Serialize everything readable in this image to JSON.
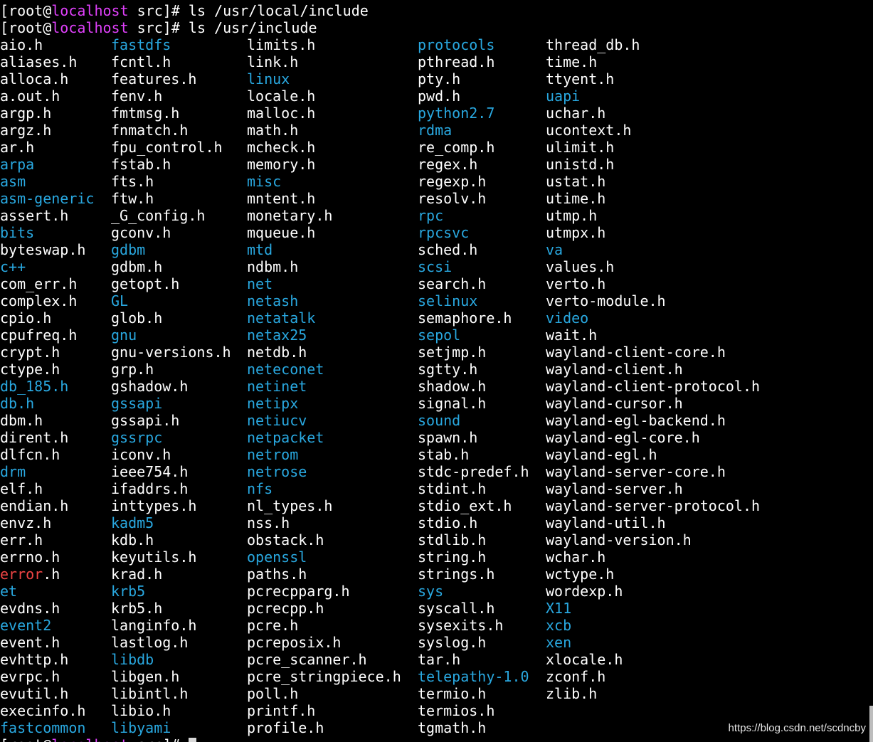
{
  "terminal": {
    "colors": {
      "background": "#000000",
      "text": "#ffffff",
      "directory": "#29a8e0",
      "hostname": "#e040fb",
      "broken_link": "#ef4444"
    },
    "prompt_lines": [
      {
        "user_part": "[root@",
        "host": "localhost",
        "path_part": " src]# ",
        "command": "ls /usr/local/include"
      },
      {
        "user_part": "[root@",
        "host": "localhost",
        "path_part": " src]# ",
        "command": "ls /usr/include"
      }
    ],
    "bottom_prompt": {
      "user_part": "[root@",
      "host": "localhost",
      "path_part": " src]# "
    }
  },
  "listing": {
    "columns": [
      [
        {
          "name": "aio.h",
          "type": "file"
        },
        {
          "name": "aliases.h",
          "type": "file"
        },
        {
          "name": "alloca.h",
          "type": "file"
        },
        {
          "name": "a.out.h",
          "type": "file"
        },
        {
          "name": "argp.h",
          "type": "file"
        },
        {
          "name": "argz.h",
          "type": "file"
        },
        {
          "name": "ar.h",
          "type": "file"
        },
        {
          "name": "arpa",
          "type": "dir"
        },
        {
          "name": "asm",
          "type": "dir"
        },
        {
          "name": "asm-generic",
          "type": "dir"
        },
        {
          "name": "assert.h",
          "type": "file"
        },
        {
          "name": "bits",
          "type": "dir"
        },
        {
          "name": "byteswap.h",
          "type": "file"
        },
        {
          "name": "c++",
          "type": "dir"
        },
        {
          "name": "com_err.h",
          "type": "file"
        },
        {
          "name": "complex.h",
          "type": "file"
        },
        {
          "name": "cpio.h",
          "type": "file"
        },
        {
          "name": "cpufreq.h",
          "type": "file"
        },
        {
          "name": "crypt.h",
          "type": "file"
        },
        {
          "name": "ctype.h",
          "type": "file"
        },
        {
          "name": "db_185.h",
          "type": "link"
        },
        {
          "name": "db.h",
          "type": "link"
        },
        {
          "name": "dbm.h",
          "type": "file"
        },
        {
          "name": "dirent.h",
          "type": "file"
        },
        {
          "name": "dlfcn.h",
          "type": "file"
        },
        {
          "name": "drm",
          "type": "dir"
        },
        {
          "name": "elf.h",
          "type": "file"
        },
        {
          "name": "endian.h",
          "type": "file"
        },
        {
          "name": "envz.h",
          "type": "file"
        },
        {
          "name": "err.h",
          "type": "file"
        },
        {
          "name": "errno.h",
          "type": "file"
        },
        {
          "name": "error",
          "suffix": ".h",
          "type": "broken"
        },
        {
          "name": "et",
          "type": "dir"
        },
        {
          "name": "evdns.h",
          "type": "file"
        },
        {
          "name": "event2",
          "type": "dir"
        },
        {
          "name": "event.h",
          "type": "file"
        },
        {
          "name": "evhttp.h",
          "type": "file"
        },
        {
          "name": "evrpc.h",
          "type": "file"
        },
        {
          "name": "evutil.h",
          "type": "file"
        },
        {
          "name": "execinfo.h",
          "type": "file"
        },
        {
          "name": "fastcommon",
          "type": "dir"
        }
      ],
      [
        {
          "name": "fastdfs",
          "type": "dir"
        },
        {
          "name": "fcntl.h",
          "type": "file"
        },
        {
          "name": "features.h",
          "type": "file"
        },
        {
          "name": "fenv.h",
          "type": "file"
        },
        {
          "name": "fmtmsg.h",
          "type": "file"
        },
        {
          "name": "fnmatch.h",
          "type": "file"
        },
        {
          "name": "fpu_control.h",
          "type": "file"
        },
        {
          "name": "fstab.h",
          "type": "file"
        },
        {
          "name": "fts.h",
          "type": "file"
        },
        {
          "name": "ftw.h",
          "type": "file"
        },
        {
          "name": "_G_config.h",
          "type": "file"
        },
        {
          "name": "gconv.h",
          "type": "file"
        },
        {
          "name": "gdbm",
          "type": "dir"
        },
        {
          "name": "gdbm.h",
          "type": "file"
        },
        {
          "name": "getopt.h",
          "type": "file"
        },
        {
          "name": "GL",
          "type": "dir"
        },
        {
          "name": "glob.h",
          "type": "file"
        },
        {
          "name": "gnu",
          "type": "dir"
        },
        {
          "name": "gnu-versions.h",
          "type": "file"
        },
        {
          "name": "grp.h",
          "type": "file"
        },
        {
          "name": "gshadow.h",
          "type": "file"
        },
        {
          "name": "gssapi",
          "type": "dir"
        },
        {
          "name": "gssapi.h",
          "type": "file"
        },
        {
          "name": "gssrpc",
          "type": "dir"
        },
        {
          "name": "iconv.h",
          "type": "file"
        },
        {
          "name": "ieee754.h",
          "type": "file"
        },
        {
          "name": "ifaddrs.h",
          "type": "file"
        },
        {
          "name": "inttypes.h",
          "type": "file"
        },
        {
          "name": "kadm5",
          "type": "dir"
        },
        {
          "name": "kdb.h",
          "type": "file"
        },
        {
          "name": "keyutils.h",
          "type": "file"
        },
        {
          "name": "krad.h",
          "type": "file"
        },
        {
          "name": "krb5",
          "type": "dir"
        },
        {
          "name": "krb5.h",
          "type": "file"
        },
        {
          "name": "langinfo.h",
          "type": "file"
        },
        {
          "name": "lastlog.h",
          "type": "file"
        },
        {
          "name": "libdb",
          "type": "dir"
        },
        {
          "name": "libgen.h",
          "type": "file"
        },
        {
          "name": "libintl.h",
          "type": "file"
        },
        {
          "name": "libio.h",
          "type": "file"
        },
        {
          "name": "libyami",
          "type": "dir"
        }
      ],
      [
        {
          "name": "limits.h",
          "type": "file"
        },
        {
          "name": "link.h",
          "type": "file"
        },
        {
          "name": "linux",
          "type": "dir"
        },
        {
          "name": "locale.h",
          "type": "file"
        },
        {
          "name": "malloc.h",
          "type": "file"
        },
        {
          "name": "math.h",
          "type": "file"
        },
        {
          "name": "mcheck.h",
          "type": "file"
        },
        {
          "name": "memory.h",
          "type": "file"
        },
        {
          "name": "misc",
          "type": "dir"
        },
        {
          "name": "mntent.h",
          "type": "file"
        },
        {
          "name": "monetary.h",
          "type": "file"
        },
        {
          "name": "mqueue.h",
          "type": "file"
        },
        {
          "name": "mtd",
          "type": "dir"
        },
        {
          "name": "ndbm.h",
          "type": "file"
        },
        {
          "name": "net",
          "type": "dir"
        },
        {
          "name": "netash",
          "type": "dir"
        },
        {
          "name": "netatalk",
          "type": "dir"
        },
        {
          "name": "netax25",
          "type": "dir"
        },
        {
          "name": "netdb.h",
          "type": "file"
        },
        {
          "name": "neteconet",
          "type": "dir"
        },
        {
          "name": "netinet",
          "type": "dir"
        },
        {
          "name": "netipx",
          "type": "dir"
        },
        {
          "name": "netiucv",
          "type": "dir"
        },
        {
          "name": "netpacket",
          "type": "dir"
        },
        {
          "name": "netrom",
          "type": "dir"
        },
        {
          "name": "netrose",
          "type": "dir"
        },
        {
          "name": "nfs",
          "type": "dir"
        },
        {
          "name": "nl_types.h",
          "type": "file"
        },
        {
          "name": "nss.h",
          "type": "file"
        },
        {
          "name": "obstack.h",
          "type": "file"
        },
        {
          "name": "openssl",
          "type": "dir"
        },
        {
          "name": "paths.h",
          "type": "file"
        },
        {
          "name": "pcrecpparg.h",
          "type": "file"
        },
        {
          "name": "pcrecpp.h",
          "type": "file"
        },
        {
          "name": "pcre.h",
          "type": "file"
        },
        {
          "name": "pcreposix.h",
          "type": "file"
        },
        {
          "name": "pcre_scanner.h",
          "type": "file"
        },
        {
          "name": "pcre_stringpiece.h",
          "type": "file"
        },
        {
          "name": "poll.h",
          "type": "file"
        },
        {
          "name": "printf.h",
          "type": "file"
        },
        {
          "name": "profile.h",
          "type": "file"
        }
      ],
      [
        {
          "name": "protocols",
          "type": "dir"
        },
        {
          "name": "pthread.h",
          "type": "file"
        },
        {
          "name": "pty.h",
          "type": "file"
        },
        {
          "name": "pwd.h",
          "type": "file"
        },
        {
          "name": "python2.7",
          "type": "dir"
        },
        {
          "name": "rdma",
          "type": "dir"
        },
        {
          "name": "re_comp.h",
          "type": "file"
        },
        {
          "name": "regex.h",
          "type": "file"
        },
        {
          "name": "regexp.h",
          "type": "file"
        },
        {
          "name": "resolv.h",
          "type": "file"
        },
        {
          "name": "rpc",
          "type": "dir"
        },
        {
          "name": "rpcsvc",
          "type": "dir"
        },
        {
          "name": "sched.h",
          "type": "file"
        },
        {
          "name": "scsi",
          "type": "dir"
        },
        {
          "name": "search.h",
          "type": "file"
        },
        {
          "name": "selinux",
          "type": "dir"
        },
        {
          "name": "semaphore.h",
          "type": "file"
        },
        {
          "name": "sepol",
          "type": "dir"
        },
        {
          "name": "setjmp.h",
          "type": "file"
        },
        {
          "name": "sgtty.h",
          "type": "file"
        },
        {
          "name": "shadow.h",
          "type": "file"
        },
        {
          "name": "signal.h",
          "type": "file"
        },
        {
          "name": "sound",
          "type": "dir"
        },
        {
          "name": "spawn.h",
          "type": "file"
        },
        {
          "name": "stab.h",
          "type": "file"
        },
        {
          "name": "stdc-predef.h",
          "type": "file"
        },
        {
          "name": "stdint.h",
          "type": "file"
        },
        {
          "name": "stdio_ext.h",
          "type": "file"
        },
        {
          "name": "stdio.h",
          "type": "file"
        },
        {
          "name": "stdlib.h",
          "type": "file"
        },
        {
          "name": "string.h",
          "type": "file"
        },
        {
          "name": "strings.h",
          "type": "file"
        },
        {
          "name": "sys",
          "type": "dir"
        },
        {
          "name": "syscall.h",
          "type": "file"
        },
        {
          "name": "sysexits.h",
          "type": "file"
        },
        {
          "name": "syslog.h",
          "type": "file"
        },
        {
          "name": "tar.h",
          "type": "file"
        },
        {
          "name": "telepathy-1.0",
          "type": "dir"
        },
        {
          "name": "termio.h",
          "type": "file"
        },
        {
          "name": "termios.h",
          "type": "file"
        },
        {
          "name": "tgmath.h",
          "type": "file"
        }
      ],
      [
        {
          "name": "thread_db.h",
          "type": "file"
        },
        {
          "name": "time.h",
          "type": "file"
        },
        {
          "name": "ttyent.h",
          "type": "file"
        },
        {
          "name": "uapi",
          "type": "dir"
        },
        {
          "name": "uchar.h",
          "type": "file"
        },
        {
          "name": "ucontext.h",
          "type": "file"
        },
        {
          "name": "ulimit.h",
          "type": "file"
        },
        {
          "name": "unistd.h",
          "type": "file"
        },
        {
          "name": "ustat.h",
          "type": "file"
        },
        {
          "name": "utime.h",
          "type": "file"
        },
        {
          "name": "utmp.h",
          "type": "file"
        },
        {
          "name": "utmpx.h",
          "type": "file"
        },
        {
          "name": "va",
          "type": "dir"
        },
        {
          "name": "values.h",
          "type": "file"
        },
        {
          "name": "verto.h",
          "type": "file"
        },
        {
          "name": "verto-module.h",
          "type": "file"
        },
        {
          "name": "video",
          "type": "dir"
        },
        {
          "name": "wait.h",
          "type": "file"
        },
        {
          "name": "wayland-client-core.h",
          "type": "file"
        },
        {
          "name": "wayland-client.h",
          "type": "file"
        },
        {
          "name": "wayland-client-protocol.h",
          "type": "file"
        },
        {
          "name": "wayland-cursor.h",
          "type": "file"
        },
        {
          "name": "wayland-egl-backend.h",
          "type": "file"
        },
        {
          "name": "wayland-egl-core.h",
          "type": "file"
        },
        {
          "name": "wayland-egl.h",
          "type": "file"
        },
        {
          "name": "wayland-server-core.h",
          "type": "file"
        },
        {
          "name": "wayland-server.h",
          "type": "file"
        },
        {
          "name": "wayland-server-protocol.h",
          "type": "file"
        },
        {
          "name": "wayland-util.h",
          "type": "file"
        },
        {
          "name": "wayland-version.h",
          "type": "file"
        },
        {
          "name": "wchar.h",
          "type": "file"
        },
        {
          "name": "wctype.h",
          "type": "file"
        },
        {
          "name": "wordexp.h",
          "type": "file"
        },
        {
          "name": "X11",
          "type": "dir"
        },
        {
          "name": "xcb",
          "type": "dir"
        },
        {
          "name": "xen",
          "type": "dir"
        },
        {
          "name": "xlocale.h",
          "type": "file"
        },
        {
          "name": "zconf.h",
          "type": "file"
        },
        {
          "name": "zlib.h",
          "type": "file"
        }
      ]
    ]
  },
  "watermark": {
    "text": "https://blog.csdn.net/scdncby"
  }
}
